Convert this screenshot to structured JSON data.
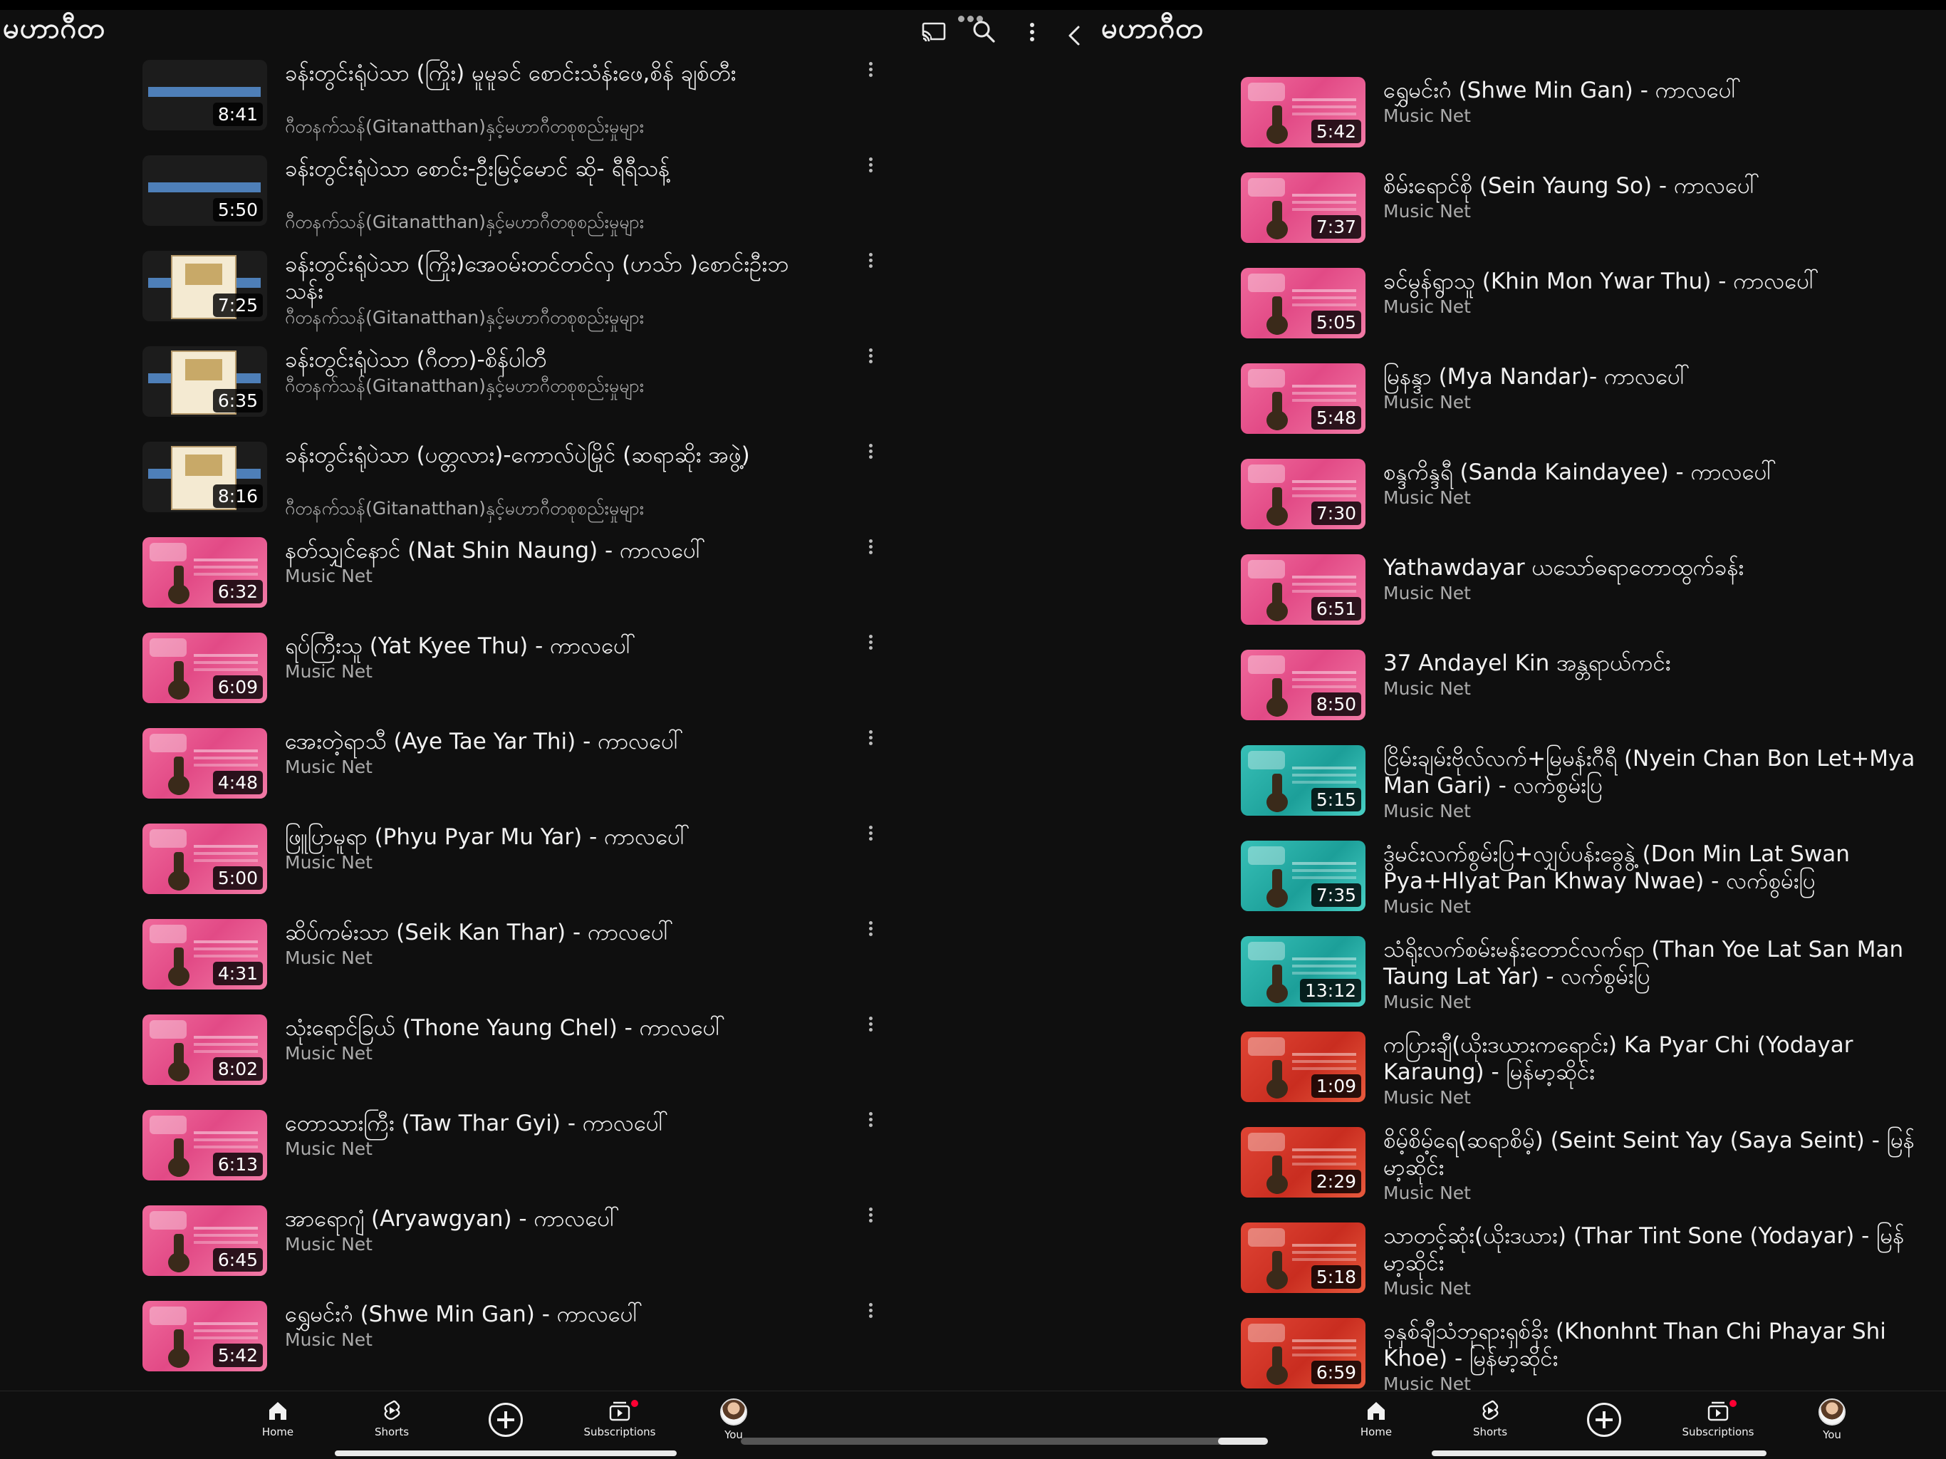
{
  "left": {
    "title": "မဟာဂီတ",
    "videos": [
      {
        "title": "ခန်းတွင်းရုံပဲသာ (ကြိုး) မူမူခင် စောင်းသံန်းဖေ,စိန် ချစ်တီး",
        "channel": "ဂီတနက်သန်(Gitanatthan)နှင့်မဟာဂီတစုစည်းမှုများ",
        "duration": "8:41",
        "thumb": "dark-bar"
      },
      {
        "title": "ခန်းတွင်းရုံပဲသာ စောင်း-ဦးမြင့်မောင် ဆို- ရီရီသန့်",
        "channel": "ဂီတနက်သန်(Gitanatthan)နှင့်မဟာဂီတစုစည်းမှုများ",
        "duration": "5:50",
        "thumb": "dark-bar"
      },
      {
        "title": "ခန်းတွင်းရုံပဲသာ (ကြိုး)အေဝမ်းတင်တင်လှ (ဟသ်ာ )စောင်းဦးဘသန်း",
        "channel": "ဂီတနက်သန်(Gitanatthan)နှင့်မဟာဂီတစုစည်းမှုများ",
        "duration": "7:25",
        "thumb": "dark-card"
      },
      {
        "title": "ခန်းတွင်းရုံပဲသာ (ဂီတာ)-စိန်ပါတီ",
        "channel": "ဂီတနက်သန်(Gitanatthan)နှင့်မဟာဂီတစုစည်းမှုများ",
        "duration": "6:35",
        "thumb": "dark-card"
      },
      {
        "title": "ခန်းတွင်းရုံပဲသာ (ပတ္တလား)-ကောလ်ပဲမြိုင် (ဆရာဆိုး အဖွဲ့)",
        "channel": "ဂီတနက်သန်(Gitanatthan)နှင့်မဟာဂီတစုစည်းမှုများ",
        "duration": "8:16",
        "thumb": "dark-card"
      },
      {
        "title": "နတ်သျှင်နောင် (Nat Shin Naung) - ကာလပေါ်",
        "channel": "Music Net",
        "duration": "6:32",
        "thumb": "pink"
      },
      {
        "title": "ရပ်ကြီးသူ (Yat Kyee Thu) - ကာလပေါ်",
        "channel": "Music Net",
        "duration": "6:09",
        "thumb": "pink"
      },
      {
        "title": "အေးတဲ့ရာသီ (Aye Tae Yar Thi) - ကာလပေါ်",
        "channel": "Music Net",
        "duration": "4:48",
        "thumb": "pink"
      },
      {
        "title": "ဖြူပြာမူရာ (Phyu Pyar Mu Yar) - ကာလပေါ်",
        "channel": "Music Net",
        "duration": "5:00",
        "thumb": "pink"
      },
      {
        "title": "ဆိပ်ကမ်းသာ (Seik Kan Thar) - ကာလပေါ်",
        "channel": "Music Net",
        "duration": "4:31",
        "thumb": "pink"
      },
      {
        "title": "သုံးရောင်ခြယ် (Thone Yaung Chel) - ကာလပေါ်",
        "channel": "Music Net",
        "duration": "8:02",
        "thumb": "pink"
      },
      {
        "title": "တောသားကြီး (Taw Thar Gyi) - ကာလပေါ်",
        "channel": "Music Net",
        "duration": "6:13",
        "thumb": "pink"
      },
      {
        "title": "အာရောဂျံ (Aryawgyan) - ကာလပေါ်",
        "channel": "Music Net",
        "duration": "6:45",
        "thumb": "pink"
      },
      {
        "title": "ရွှေမင်းဂံ (Shwe Min Gan) - ကာလပေါ်",
        "channel": "Music Net",
        "duration": "5:42",
        "thumb": "pink"
      }
    ]
  },
  "right": {
    "title": "မဟာဂီတ",
    "videos": [
      {
        "title": "ရွှေမင်းဂံ (Shwe Min Gan) - ကာလပေါ်",
        "channel": "Music Net",
        "duration": "5:42",
        "thumb": "pink"
      },
      {
        "title": "စိမ်းရောင်စို (Sein Yaung So) - ကာလပေါ်",
        "channel": "Music Net",
        "duration": "7:37",
        "thumb": "pink"
      },
      {
        "title": "ခင်မွန်ရွာသူ (Khin Mon Ywar Thu) - ကာလပေါ်",
        "channel": "Music Net",
        "duration": "5:05",
        "thumb": "pink"
      },
      {
        "title": "မြနန္ဒာ (Mya Nandar)- ကာလပေါ်",
        "channel": "Music Net",
        "duration": "5:48",
        "thumb": "pink"
      },
      {
        "title": "စန္ဒကိန္ဒရီ (Sanda Kaindayee) - ကာလပေါ်",
        "channel": "Music Net",
        "duration": "7:30",
        "thumb": "pink"
      },
      {
        "title": "Yathawdayar ယသော်ဓရာတောထွက်ခန်း",
        "channel": "Music Net",
        "duration": "6:51",
        "thumb": "pink"
      },
      {
        "title": "37 Andayel Kin အန္တရာယ်ကင်း",
        "channel": "Music Net",
        "duration": "8:50",
        "thumb": "pink"
      },
      {
        "title": "ငြိမ်းချမ်းဗိုလ်လက်+မြမန်းဂီရီ (Nyein Chan Bon Let+Mya Man Gari) - လက်စွမ်းပြ",
        "channel": "Music Net",
        "duration": "5:15",
        "thumb": "teal"
      },
      {
        "title": "ဒွံမင်းလက်စွမ်းပြ+လျှပ်ပန်းခွေနွဲ့ (Don Min Lat Swan Pya+Hlyat Pan Khway Nwae) - လက်စွမ်းပြ",
        "channel": "Music Net",
        "duration": "7:35",
        "thumb": "teal"
      },
      {
        "title": "သံရိုးလက်စမ်းမန်းတောင်လက်ရာ (Than Yoe Lat San Man Taung Lat Yar) - လက်စွမ်းပြ",
        "channel": "Music Net",
        "duration": "13:12",
        "thumb": "teal"
      },
      {
        "title": "ကပြားချီ(ယိုးဒယားကရောင်း) Ka Pyar Chi (Yodayar Karaung) - မြန်မာ့ဆိုင်း",
        "channel": "Music Net",
        "duration": "1:09",
        "thumb": "red"
      },
      {
        "title": "စိမ့်စိမ့်ရေ(ဆရာစိမ့်) (Seint Seint Yay (Saya Seint) - မြန်မာ့ဆိုင်း",
        "channel": "Music Net",
        "duration": "2:29",
        "thumb": "red"
      },
      {
        "title": "သာတင့်ဆုံး(ယိုးဒယား) (Thar Tint Sone (Yodayar) - မြန်မာ့ဆိုင်း",
        "channel": "Music Net",
        "duration": "5:18",
        "thumb": "red"
      },
      {
        "title": "ခုနှစ်ချီသံဘုရားရှစ်ခိုး (Khonhnt Than Chi Phayar Shi Khoe) - မြန်မာ့ဆိုင်း",
        "channel": "Music Net",
        "duration": "6:59",
        "thumb": "red"
      }
    ]
  },
  "nav": {
    "home": "Home",
    "shorts": "Shorts",
    "subscriptions": "Subscriptions",
    "you": "You"
  },
  "icons": {
    "cast": "cast-icon",
    "search": "search-icon",
    "more": "more-vert-icon",
    "back": "chevron-left-icon"
  },
  "colors": {
    "background": "#0f0f0f",
    "text": "#f1f1f1",
    "secondary_text": "#aaaaaa",
    "notification": "#ff0033"
  }
}
